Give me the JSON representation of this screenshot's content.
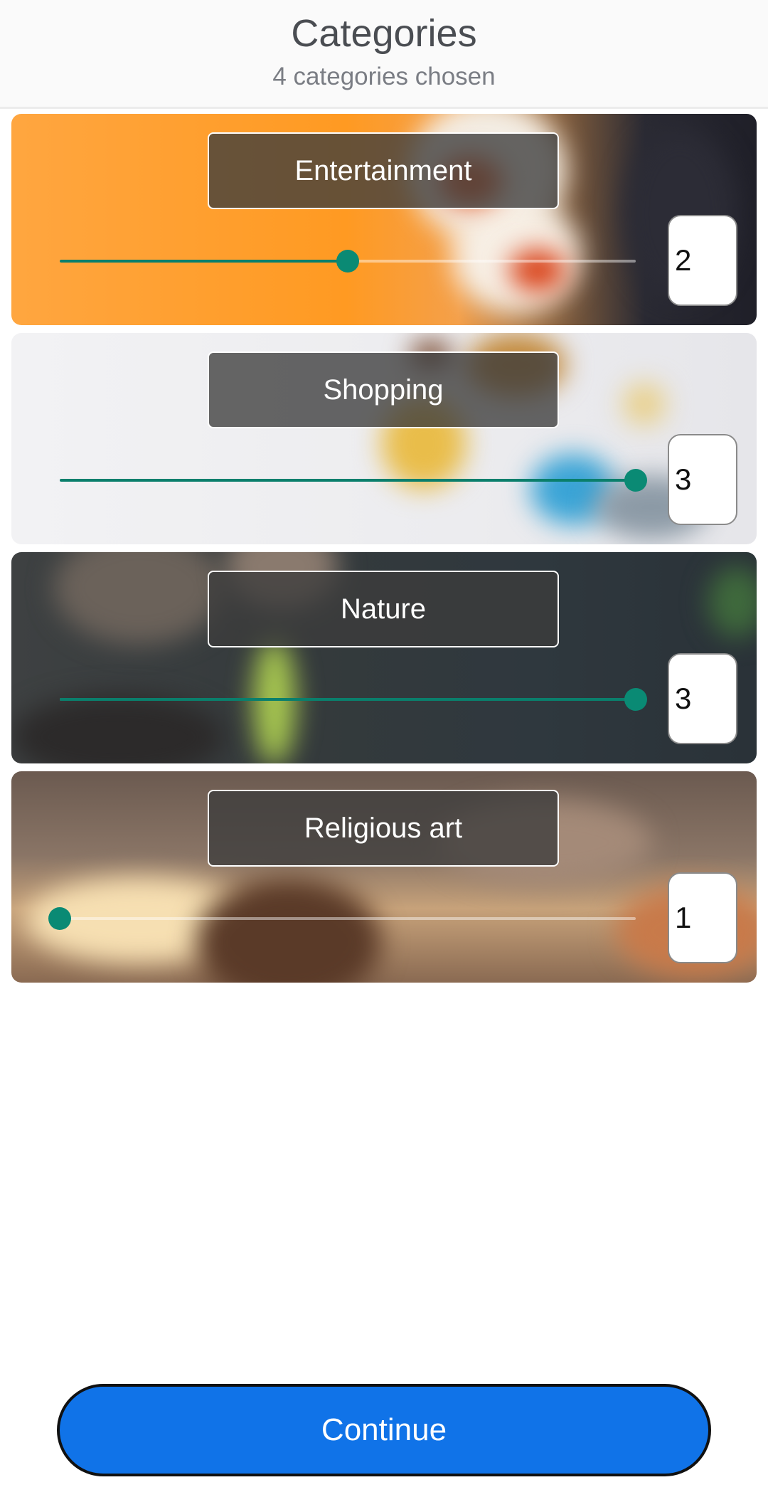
{
  "header": {
    "title": "Categories",
    "subtitle": "4 categories chosen"
  },
  "categories": [
    {
      "label": "Entertainment",
      "value": "2",
      "level": 0.5,
      "image": "popcorn-and-clapperboard-photo"
    },
    {
      "label": "Shopping",
      "value": "3",
      "level": 1.0,
      "image": "shopping-cart-and-bags-photo"
    },
    {
      "label": "Nature",
      "value": "3",
      "level": 1.0,
      "image": "sprout-in-hand-photo"
    },
    {
      "label": "Religious art",
      "value": "1",
      "level": 0.0,
      "image": "temple-dome-at-sunset-photo"
    }
  ],
  "continue_label": "Continue",
  "colors": {
    "accent": "#0a8a74",
    "button": "#1073e8"
  }
}
